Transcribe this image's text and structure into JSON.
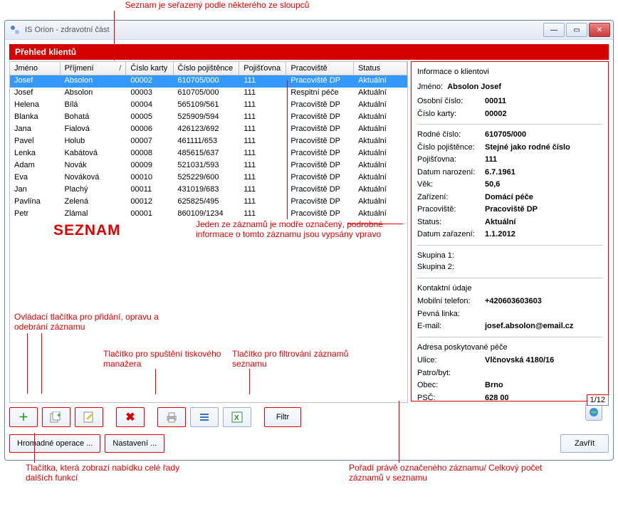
{
  "window": {
    "title": "IS Orion - zdravotní část"
  },
  "panel_title": "Přehled klientů",
  "columns": [
    "Jméno",
    "Příjmení",
    "Číslo karty",
    "Číslo pojištěnce",
    "Pojišťovna",
    "Pracoviště",
    "Status"
  ],
  "sorted_col": 1,
  "selected_row": 0,
  "rows": [
    [
      "Josef",
      "Absolon",
      "00002",
      "610705/000",
      "111",
      "Pracoviště DP",
      "Aktuální"
    ],
    [
      "Josef",
      "Absolon",
      "00003",
      "610705/000",
      "111",
      "Respitní péče",
      "Aktuální"
    ],
    [
      "Helena",
      "Bílá",
      "00004",
      "565109/561",
      "111",
      "Pracoviště DP",
      "Aktuální"
    ],
    [
      "Blanka",
      "Bohatá",
      "00005",
      "525909/594",
      "111",
      "Pracoviště DP",
      "Aktuální"
    ],
    [
      "Jana",
      "Fialová",
      "00006",
      "426123/692",
      "111",
      "Pracoviště DP",
      "Aktuální"
    ],
    [
      "Pavel",
      "Holub",
      "00007",
      "461111/653",
      "111",
      "Pracoviště DP",
      "Aktuální"
    ],
    [
      "Lenka",
      "Kabátová",
      "00008",
      "485615/637",
      "111",
      "Pracoviště DP",
      "Aktuální"
    ],
    [
      "Adam",
      "Novák",
      "00009",
      "521031/593",
      "111",
      "Pracoviště DP",
      "Aktuální"
    ],
    [
      "Eva",
      "Nováková",
      "00010",
      "525229/600",
      "111",
      "Pracoviště DP",
      "Aktuální"
    ],
    [
      "Jan",
      "Plachý",
      "00011",
      "431019/683",
      "111",
      "Pracoviště DP",
      "Aktuální"
    ],
    [
      "Pavlína",
      "Zelená",
      "00012",
      "625825/495",
      "111",
      "Pracoviště DP",
      "Aktuální"
    ],
    [
      "Petr",
      "Zlámal",
      "00001",
      "860109/1234",
      "111",
      "Pracoviště DP",
      "Aktuální"
    ]
  ],
  "detail": {
    "heading": "Informace o klientovi",
    "name_label": "Jméno:",
    "name_value": "Absolon Josef",
    "fields1": {
      "l1": "Osobní číslo:",
      "v1": "00011",
      "l2": "Číslo karty:",
      "v2": "00002"
    },
    "fields2": {
      "l1": "Rodné číslo:",
      "v1": "610705/000",
      "l2": "Číslo pojištěnce:",
      "v2": "Stejné jako rodné číslo",
      "l3": "Pojišťovna:",
      "v3": "111",
      "l4": "Datum narození:",
      "v4": "6.7.1961",
      "l5": "Věk:",
      "v5": "50,6",
      "l6": "Zařízení:",
      "v6": "Domácí péče",
      "l7": "Pracoviště:",
      "v7": "Pracoviště DP",
      "l8": "Status:",
      "v8": "Aktuální",
      "l9": "Datum zařazení:",
      "v9": "1.1.2012"
    },
    "groups": {
      "g1": "Skupina 1:",
      "g2": "Skupina 2:"
    },
    "contact_heading": "Kontaktní údaje",
    "contact": {
      "l1": "Mobilní telefon:",
      "v1": "+420603603603",
      "l2": "Pevná linka:",
      "v2": "",
      "l3": "E-mail:",
      "v3": "josef.absolon@email.cz"
    },
    "addr_heading": "Adresa poskytované péče",
    "addr": {
      "l1": "Ulice:",
      "v1": "Vlčnovská 4180/16",
      "l2": "Patro/byt:",
      "v2": "",
      "l3": "Obec:",
      "v3": "Brno",
      "l4": "PSČ:",
      "v4": "628 00"
    }
  },
  "toolbar": {
    "filter": "Filtr"
  },
  "pager": "1/12",
  "bottom": {
    "bulk": "Hromadné operace ...",
    "settings": "Nastavení ...",
    "close": "Zavřít"
  },
  "annotations": {
    "top": "Seznam je seřazený podle některého ze sloupců",
    "seznam": "SEZNAM",
    "mid": "Jeden ze záznamů je modře označený, podrobné informace o tomto záznamu jsou vypsány vpravo",
    "crud": "Ovládací tlačítka pro přidání, opravu a odebrání záznamu",
    "print": "Tlačítko pro spuštění tiskového manažera",
    "filter": "Tlačítko pro filtrování záznamů seznamu",
    "bottom_left": "Tlačítka, která zobrazí nabídku celé řady dalších funkcí",
    "bottom_right": "Pořadí právě označeného záznamu/ Celkový počet záznamů v seznamu"
  }
}
